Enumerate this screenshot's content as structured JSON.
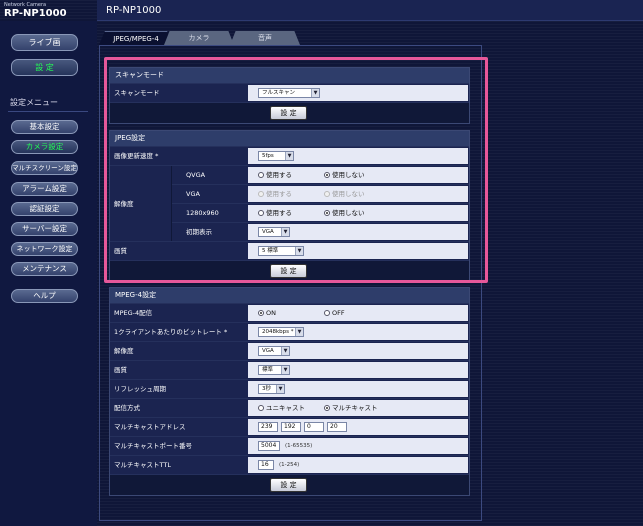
{
  "header": {
    "brand_small": "Network Camera",
    "brand_model": "RP-NP1000",
    "title": "RP-NP1000"
  },
  "sidebar": {
    "live_label": "ライブ画",
    "setup_label": "設 定",
    "menu_heading": "設定メニュー",
    "items": [
      {
        "label": "基本設定",
        "active": false
      },
      {
        "label": "カメラ設定",
        "active": true
      },
      {
        "label": "マルチスクリーン設定",
        "active": false
      },
      {
        "label": "アラーム設定",
        "active": false
      },
      {
        "label": "認証設定",
        "active": false
      },
      {
        "label": "サーバー設定",
        "active": false
      },
      {
        "label": "ネットワーク設定",
        "active": false
      },
      {
        "label": "メンテナンス",
        "active": false
      }
    ],
    "help_label": "ヘルプ"
  },
  "tabs": [
    {
      "label": "JPEG/MPEG-4",
      "active": true
    },
    {
      "label": "カメラ",
      "active": false
    },
    {
      "label": "音声",
      "active": false
    }
  ],
  "scan": {
    "heading": "スキャンモード",
    "label": "スキャンモード",
    "value": "フルスキャン",
    "set_button": "設 定"
  },
  "jpeg": {
    "heading": "JPEG設定",
    "rate_label": "画像更新速度 *",
    "rate_value": "5fps",
    "resolution_label": "解像度",
    "qvga_label": "QVGA",
    "vga_label": "VGA",
    "r1280_label": "1280x960",
    "initial_label": "初期表示",
    "initial_value": "VGA",
    "use_label": "使用する",
    "nouse_label": "使用しない",
    "quality_label": "画質",
    "quality_value": "5 標準",
    "set_button": "設 定"
  },
  "mpeg4": {
    "heading": "MPEG-4設定",
    "dist_label": "MPEG-4配信",
    "on_label": "ON",
    "off_label": "OFF",
    "bitrate_label": "1クライアントあたりのビットレート *",
    "bitrate_value": "2048kbps *",
    "res_label": "解像度",
    "res_value": "VGA",
    "quality_label": "画質",
    "quality_value": "標準",
    "refresh_label": "リフレッシュ周期",
    "refresh_value": "3秒",
    "method_label": "配信方式",
    "unicast_label": "ユニキャスト",
    "multicast_label": "マルチキャスト",
    "mcast_addr_label": "マルチキャストアドレス",
    "ip1": "239",
    "ip2": "192",
    "ip3": "0",
    "ip4": "20",
    "mcast_port_label": "マルチキャストポート番号",
    "port_value": "5004",
    "port_hint": "(1-65535)",
    "ttl_label": "マルチキャストTTL",
    "ttl_value": "16",
    "ttl_hint": "(1-254)",
    "set_button": "設 定"
  },
  "colors": {
    "highlight": "#e6589a",
    "active_menu": "#22ff55"
  }
}
